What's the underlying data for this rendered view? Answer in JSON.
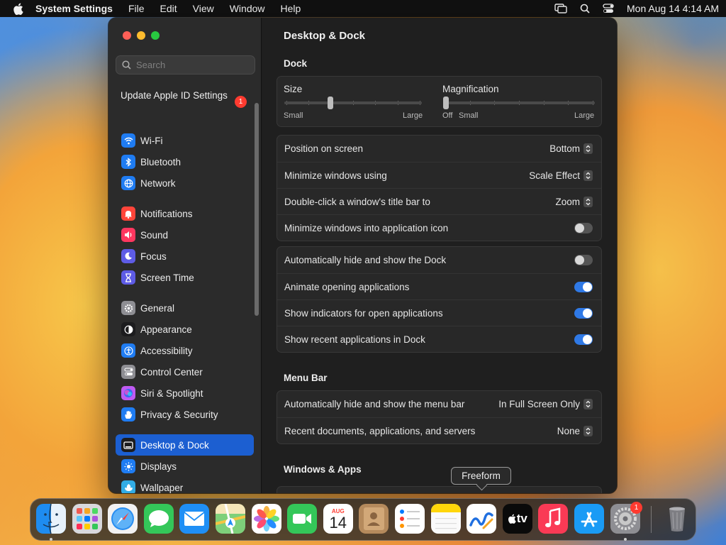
{
  "menubar": {
    "app_name": "System Settings",
    "menus": [
      "File",
      "Edit",
      "View",
      "Window",
      "Help"
    ],
    "clock": "Mon Aug 14  4:14 AM"
  },
  "window": {
    "title": "Desktop & Dock",
    "search": {
      "placeholder": "Search"
    },
    "apple_id": {
      "label": "Update Apple ID Settings",
      "badge": "1"
    },
    "sidebar": {
      "group1": [
        {
          "label": "Wi-Fi",
          "icon": "wifi-icon",
          "color": "#1f7cf2"
        },
        {
          "label": "Bluetooth",
          "icon": "bluetooth-icon",
          "color": "#1f7cf2"
        },
        {
          "label": "Network",
          "icon": "globe-icon",
          "color": "#1f7cf2"
        }
      ],
      "group2": [
        {
          "label": "Notifications",
          "icon": "bell-icon",
          "color": "#ff453a"
        },
        {
          "label": "Sound",
          "icon": "speaker-icon",
          "color": "#ff375f"
        },
        {
          "label": "Focus",
          "icon": "moon-icon",
          "color": "#5e5ce6"
        },
        {
          "label": "Screen Time",
          "icon": "hourglass-icon",
          "color": "#5e5ce6"
        }
      ],
      "group3": [
        {
          "label": "General",
          "icon": "gear-icon",
          "color": "#8e8e93"
        },
        {
          "label": "Appearance",
          "icon": "appearance-icon",
          "color": "#1c1c1e"
        },
        {
          "label": "Accessibility",
          "icon": "accessibility-icon",
          "color": "#1f7cf2"
        },
        {
          "label": "Control Center",
          "icon": "control-center-icon",
          "color": "#8e8e93"
        },
        {
          "label": "Siri & Spotlight",
          "icon": "siri-icon",
          "color": "#bf5af2"
        },
        {
          "label": "Privacy & Security",
          "icon": "hand-icon",
          "color": "#1f7cf2"
        }
      ],
      "group4": [
        {
          "label": "Desktop & Dock",
          "icon": "dock-icon",
          "color": "#1c1c1e",
          "active": true
        },
        {
          "label": "Displays",
          "icon": "sun-icon",
          "color": "#1f7cf2"
        },
        {
          "label": "Wallpaper",
          "icon": "wallpaper-icon",
          "color": "#32ade6"
        }
      ]
    },
    "dock_section": {
      "title": "Dock",
      "size": {
        "label": "Size",
        "min": "Small",
        "max": "Large",
        "value": 0.33
      },
      "magnification": {
        "label": "Magnification",
        "off": "Off",
        "min": "Small",
        "max": "Large",
        "value": 0
      },
      "popups": [
        {
          "label": "Position on screen",
          "value": "Bottom"
        },
        {
          "label": "Minimize windows using",
          "value": "Scale Effect"
        },
        {
          "label": "Double-click a window's title bar to",
          "value": "Zoom"
        }
      ],
      "minimize_into_icon": {
        "label": "Minimize windows into application icon",
        "on": false
      },
      "toggles": [
        {
          "label": "Automatically hide and show the Dock",
          "on": false
        },
        {
          "label": "Animate opening applications",
          "on": true
        },
        {
          "label": "Show indicators for open applications",
          "on": true
        },
        {
          "label": "Show recent applications in Dock",
          "on": true
        }
      ]
    },
    "menubar_section": {
      "title": "Menu Bar",
      "rows": [
        {
          "label": "Automatically hide and show the menu bar",
          "value": "In Full Screen Only"
        },
        {
          "label": "Recent documents, applications, and servers",
          "value": "None"
        }
      ]
    },
    "windows_apps_section": {
      "title": "Windows & Apps"
    }
  },
  "tooltip": {
    "text": "Freeform"
  },
  "dock": {
    "apps": [
      {
        "name": "Finder",
        "icon": "finder-icon",
        "running": true
      },
      {
        "name": "Launchpad",
        "icon": "launchpad-icon"
      },
      {
        "name": "Safari",
        "icon": "safari-icon"
      },
      {
        "name": "Messages",
        "icon": "messages-icon"
      },
      {
        "name": "Mail",
        "icon": "mail-icon"
      },
      {
        "name": "Maps",
        "icon": "maps-icon"
      },
      {
        "name": "Photos",
        "icon": "photos-icon"
      },
      {
        "name": "FaceTime",
        "icon": "facetime-icon"
      },
      {
        "name": "Calendar",
        "icon": "calendar-icon",
        "month": "AUG",
        "day": "14"
      },
      {
        "name": "Contacts",
        "icon": "contacts-icon"
      },
      {
        "name": "Reminders",
        "icon": "reminders-icon"
      },
      {
        "name": "Notes",
        "icon": "notes-icon"
      },
      {
        "name": "Freeform",
        "icon": "freeform-icon"
      },
      {
        "name": "TV",
        "icon": "tv-icon",
        "label": "tv"
      },
      {
        "name": "Music",
        "icon": "music-icon"
      },
      {
        "name": "App Store",
        "icon": "app-store-icon"
      },
      {
        "name": "System Settings",
        "icon": "system-settings-icon",
        "running": true,
        "badge": "1"
      },
      {
        "name": "Trash",
        "icon": "trash-icon"
      }
    ]
  }
}
